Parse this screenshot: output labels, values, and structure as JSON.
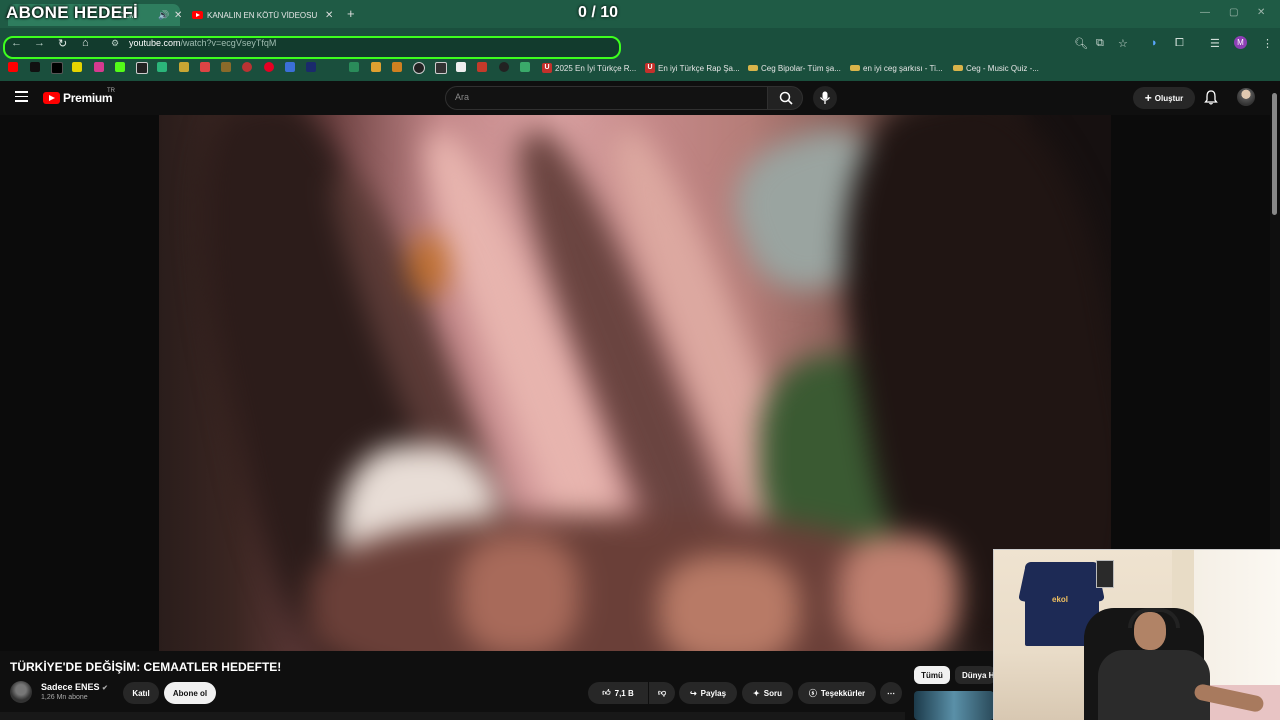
{
  "overlay": {
    "title": "ABONE HEDEFİ",
    "counter": "0 / 10"
  },
  "browser": {
    "tabs": [
      {
        "title": "TÜRKİYE'DE DEĞİŞİM: CEMAATLER HEDEFTE!",
        "visible_title": "CEM",
        "active": true
      },
      {
        "title": "KANALIN EN KÖTÜ VİDEOSU - ",
        "active": false
      }
    ],
    "url_domain": "youtube.com",
    "url_path": "/watch?v=ecgVseyTfqM",
    "bookmarks": [
      {
        "label": "2025 En İyi Türkçe R...",
        "icon_letter": "U",
        "color": "#c4302b"
      },
      {
        "label": "En iyi Türkçe Rap Şa...",
        "icon_letter": "U",
        "color": "#c4302b"
      },
      {
        "label": "Ceg Bipolar- Tüm şa...",
        "icon_letter": "",
        "color": "#d9b44a"
      },
      {
        "label": "en iyi ceg şarkısı - Ti...",
        "icon_letter": "",
        "color": "#d9b44a"
      },
      {
        "label": "Ceg - Music Quiz -...",
        "icon_letter": "",
        "color": "#d9b44a"
      }
    ],
    "profile_letter": "M"
  },
  "youtube": {
    "logo_text": "Premium",
    "logo_region": "TR",
    "search_placeholder": "Ara",
    "create_label": "Oluştur",
    "video_title": "TÜRKİYE'DE DEĞİŞİM: CEMAATLER HEDEFTE!",
    "channel_name": "Sadece ENES",
    "channel_subs": "1,26 Mn abone",
    "join_label": "Katıl",
    "subscribe_label": "Abone ol",
    "like_count": "7,1 B",
    "share_label": "Paylaş",
    "ask_label": "Soru",
    "thanks_label": "Teşekkürler",
    "chips": [
      "Tümü",
      "Dünya H"
    ]
  },
  "webcam": {
    "jersey_text": "ekol"
  },
  "colors": {
    "tabstrip": "#1f5b45",
    "toolbar": "#1a4f3d",
    "highlight": "#3dff1e",
    "yt_red": "#ff0000",
    "yt_bg": "#0f0f0f"
  }
}
